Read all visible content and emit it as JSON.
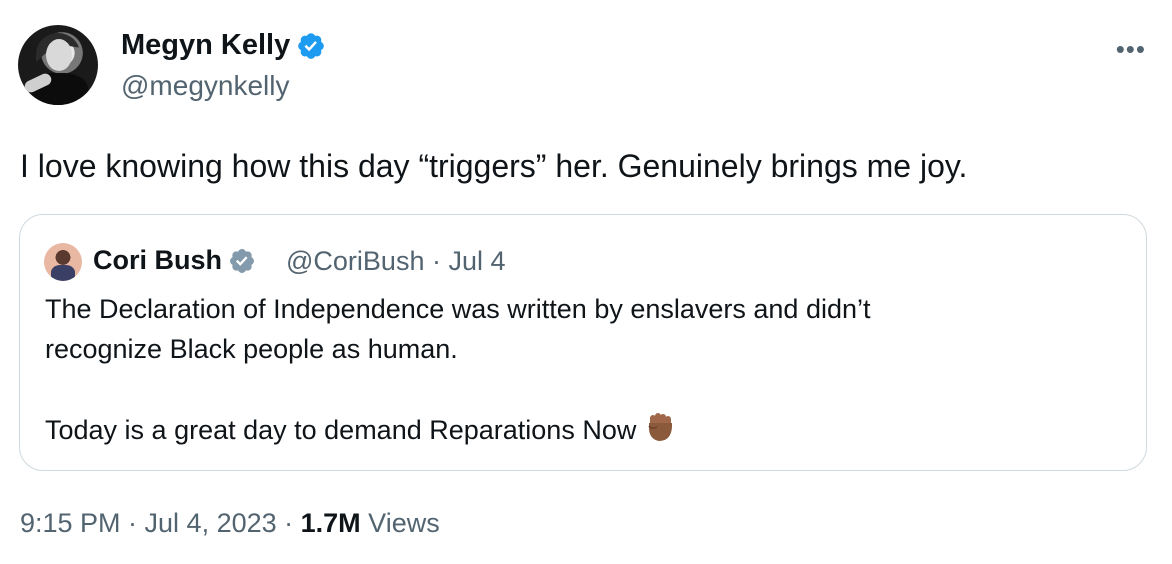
{
  "author": {
    "name": "Megyn Kelly",
    "handle": "@megynkelly",
    "verified_color": "#1d9bf0"
  },
  "tweet": {
    "text": "I love knowing how this day “triggers” her. Genuinely brings me joy."
  },
  "quoted": {
    "name": "Cori Bush",
    "meta": "@CoriBush · Jul 4",
    "verified_color": "#829aab",
    "line1": "The Declaration of Independence was written by enslavers and didn’t",
    "line2": "recognize Black people as human.",
    "line3": "Today is a great day to demand Reparations Now",
    "emoji": "raised-fist-emoji"
  },
  "footer": {
    "time_date": "9:15 PM · Jul 4, 2023 · ",
    "views_count": "1.7M",
    "views_label": " Views"
  },
  "icons": {
    "more": "more-icon"
  }
}
